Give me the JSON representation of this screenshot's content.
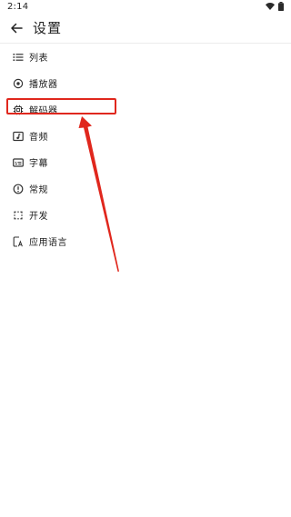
{
  "status_bar": {
    "time": "2:14"
  },
  "app_bar": {
    "back_icon": "arrow-back-icon",
    "title": "设置"
  },
  "menu": [
    {
      "name": "list",
      "icon": "list-icon",
      "label": "列表"
    },
    {
      "name": "player",
      "icon": "player-icon",
      "label": "播放器"
    },
    {
      "name": "decoder",
      "icon": "chip-icon",
      "label": "解码器"
    },
    {
      "name": "audio",
      "icon": "audio-icon",
      "label": "音频"
    },
    {
      "name": "subtitle",
      "icon": "subtitle-icon",
      "label": "字幕"
    },
    {
      "name": "general",
      "icon": "info-icon",
      "label": "常规"
    },
    {
      "name": "developer",
      "icon": "developer-icon",
      "label": "开发"
    },
    {
      "name": "app-language",
      "icon": "language-icon",
      "label": "应用语言"
    }
  ],
  "annotation": {
    "color": "#e0271d"
  }
}
